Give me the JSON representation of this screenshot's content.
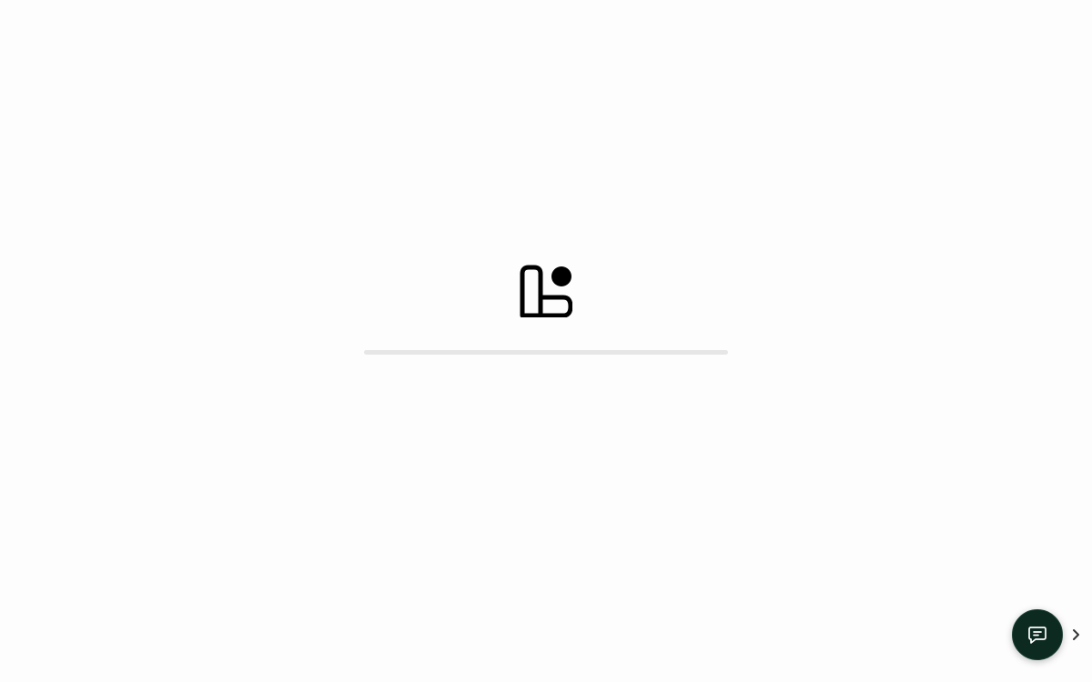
{
  "loading": {
    "logo_icon": "app-logo-icon",
    "progress_percent": 0
  },
  "chat_widget": {
    "button_icon": "chat-icon",
    "button_color": "#0c2a20",
    "arrow_icon": "chevron-right-icon"
  }
}
